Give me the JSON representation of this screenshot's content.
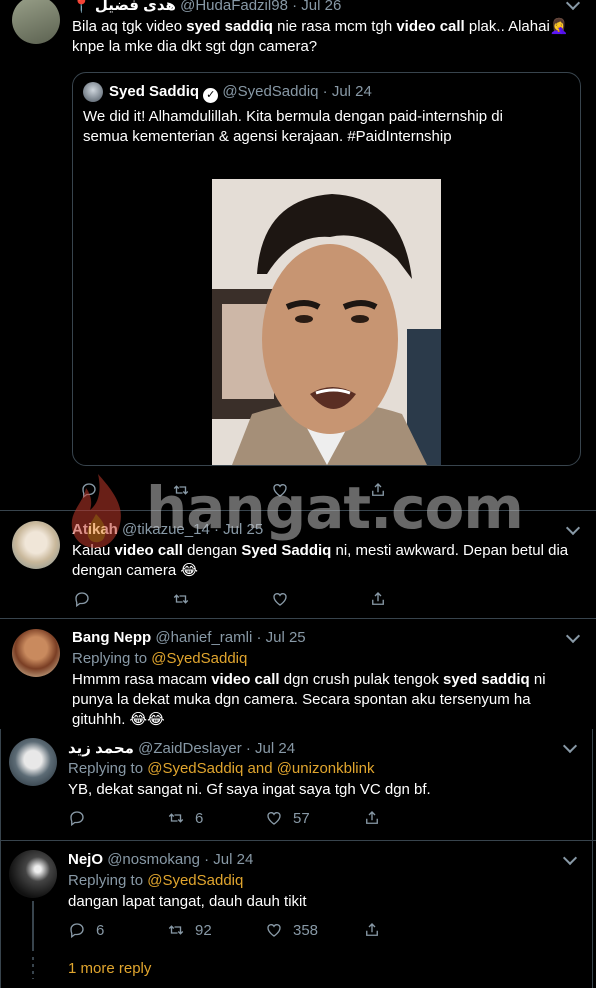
{
  "tweets": [
    {
      "name": "هدى فضيل",
      "handle": "@HudaFadzil98",
      "date": "· Jul 26",
      "text_html": "Bila aq tgk video <b>syed saddiq</b> nie rasa mcm tgh <b>video call</b> plak.. Alahai🤦‍♀️ knpe la mke dia dkt sgt dgn camera?"
    },
    {
      "name": "Atikah",
      "handle": "@tikazue_14",
      "date": "· Jul 25",
      "text_html": "Kalau <b>video call</b> dengan <b>Syed Saddiq</b> ni, mesti awkward. Depan betul dia dengan camera 😂"
    },
    {
      "name": "Bang Nepp",
      "handle": "@hanief_ramli",
      "date": "· Jul 25",
      "reply_prefix": "Replying to",
      "reply_to": "@SyedSaddiq",
      "text_html": "Hmmm rasa macam <b>video call</b> dgn crush pulak tengok <b>syed saddiq</b> ni punya la dekat muka dgn camera. Secara spontan aku tersenyum ha gituhhh. 😂😂"
    },
    {
      "name": "محمد زيد",
      "handle": "@ZaidDeslayer",
      "date": "· Jul 24",
      "reply_prefix": "Replying to",
      "reply_to": "@SyedSaddiq and @unizonkblink",
      "text": "YB, dekat sangat ni. Gf saya ingat saya tgh VC dgn bf.",
      "retweets": "6",
      "likes": "57"
    },
    {
      "name": "NejO",
      "handle": "@nosmokang",
      "date": "· Jul 24",
      "reply_prefix": "Replying to",
      "reply_to": "@SyedSaddiq",
      "text": "dangan lapat tangat, dauh dauh tikit",
      "replies": "6",
      "retweets": "92",
      "likes": "358"
    }
  ],
  "quoted": {
    "name": "Syed Saddiq",
    "handle": "@SyedSaddiq",
    "date": "· Jul 24",
    "text": "We did it! Alhamdulillah. Kita bermula dengan  paid-internship di semua kementerian & agensi kerajaan. #PaidInternship"
  },
  "more_replies": "1 more reply",
  "watermark": "hangat.com",
  "icons": [
    "chevron-down-icon",
    "reply-icon",
    "retweet-icon",
    "like-icon",
    "share-icon",
    "verified-badge-icon",
    "location-pin-icon",
    "flame-logo"
  ],
  "colors": {
    "background": "#000000",
    "muted": "#8899a6",
    "link": "#e0a52e",
    "divider": "#38444d"
  }
}
